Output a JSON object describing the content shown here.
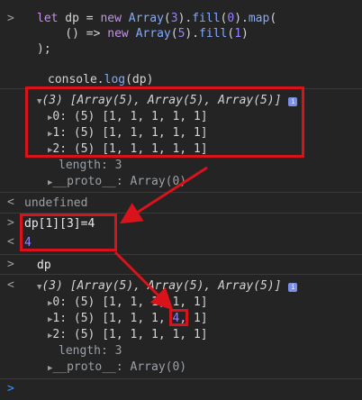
{
  "console": {
    "cmd1": {
      "line1": "let dp = new Array(3).fill(0).map(",
      "line2": "    () => new Array(5).fill(1)",
      "line3": ");",
      "line5": "console.log(dp)"
    },
    "log1": {
      "summary": "(3) [Array(5), Array(5), Array(5)]",
      "rows": [
        "0: (5) [1, 1, 1, 1, 1]",
        "1: (5) [1, 1, 1, 1, 1]",
        "2: (5) [1, 1, 1, 1, 1]"
      ],
      "length": "length: 3",
      "proto": "__proto__: Array(0)"
    },
    "result1": "undefined",
    "cmd2": "dp[1][3]=4",
    "result2": "4",
    "cmd3": "dp",
    "log2": {
      "summary": "(3) [Array(5), Array(5), Array(5)]",
      "row0": "0: (5) [1, 1, 1, 1, 1]",
      "row1_pre": "1: (5) [1, 1, 1, ",
      "row1_hl": "4",
      "row1_post": ", 1]",
      "row2": "2: (5) [1, 1, 1, 1, 1]",
      "length": "length: 3",
      "proto": "__proto__: Array(0)"
    },
    "prompt_glyph": ">",
    "result_glyph": "<",
    "info_glyph": "i",
    "colors": {
      "annotation": "#d9131b",
      "background": "#242424"
    }
  }
}
